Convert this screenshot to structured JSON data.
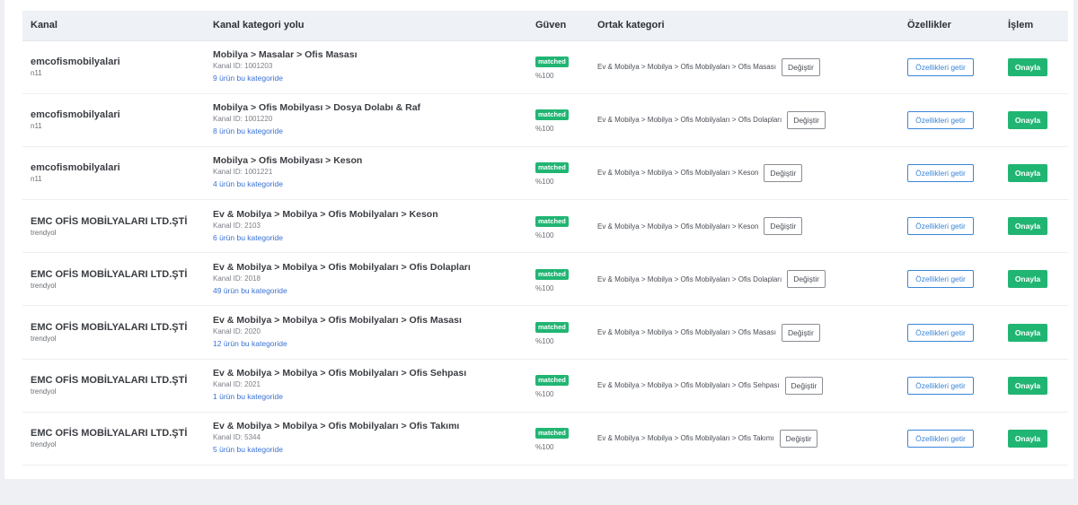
{
  "headers": {
    "kanal": "Kanal",
    "path": "Kanal kategori yolu",
    "guven": "Güven",
    "ortak": "Ortak kategori",
    "ozellikler": "Özellikler",
    "islem": "İşlem"
  },
  "rows": [
    {
      "channel": "emcofismobilyalari",
      "source": "n11",
      "path": "Mobilya > Masalar > Ofis Masası",
      "channel_id": "Kanal ID: 1001203",
      "count": "9 ürün bu kategoride",
      "badge": "matched",
      "confidence": "%100",
      "ortak": "Ev & Mobilya > Mobilya > Ofis Mobilyaları > Ofis Masası",
      "change": "Değiştir",
      "features": "Özellikleri getir",
      "approve": "Onayla"
    },
    {
      "channel": "emcofismobilyalari",
      "source": "n11",
      "path": "Mobilya > Ofis Mobilyası > Dosya Dolabı & Raf",
      "channel_id": "Kanal ID: 1001220",
      "count": "8 ürün bu kategoride",
      "badge": "matched",
      "confidence": "%100",
      "ortak": "Ev & Mobilya > Mobilya > Ofis Mobilyaları > Ofis Dolapları",
      "change": "Değiştir",
      "features": "Özellikleri getir",
      "approve": "Onayla"
    },
    {
      "channel": "emcofismobilyalari",
      "source": "n11",
      "path": "Mobilya > Ofis Mobilyası > Keson",
      "channel_id": "Kanal ID: 1001221",
      "count": "4 ürün bu kategoride",
      "badge": "matched",
      "confidence": "%100",
      "ortak": "Ev & Mobilya > Mobilya > Ofis Mobilyaları > Keson",
      "change": "Değiştir",
      "features": "Özellikleri getir",
      "approve": "Onayla"
    },
    {
      "channel": "EMC OFİS MOBİLYALARI LTD.ŞTİ",
      "source": "trendyol",
      "path": "Ev & Mobilya > Mobilya > Ofis Mobilyaları > Keson",
      "channel_id": "Kanal ID: 2103",
      "count": "6 ürün bu kategoride",
      "badge": "matched",
      "confidence": "%100",
      "ortak": "Ev & Mobilya > Mobilya > Ofis Mobilyaları > Keson",
      "change": "Değiştir",
      "features": "Özellikleri getir",
      "approve": "Onayla"
    },
    {
      "channel": "EMC OFİS MOBİLYALARI LTD.ŞTİ",
      "source": "trendyol",
      "path": "Ev & Mobilya > Mobilya > Ofis Mobilyaları > Ofis Dolapları",
      "channel_id": "Kanal ID: 2018",
      "count": "49 ürün bu kategoride",
      "badge": "matched",
      "confidence": "%100",
      "ortak": "Ev & Mobilya > Mobilya > Ofis Mobilyaları > Ofis Dolapları",
      "change": "Değiştir",
      "features": "Özellikleri getir",
      "approve": "Onayla"
    },
    {
      "channel": "EMC OFİS MOBİLYALARI LTD.ŞTİ",
      "source": "trendyol",
      "path": "Ev & Mobilya > Mobilya > Ofis Mobilyaları > Ofis Masası",
      "channel_id": "Kanal ID: 2020",
      "count": "12 ürün bu kategoride",
      "badge": "matched",
      "confidence": "%100",
      "ortak": "Ev & Mobilya > Mobilya > Ofis Mobilyaları > Ofis Masası",
      "change": "Değiştir",
      "features": "Özellikleri getir",
      "approve": "Onayla"
    },
    {
      "channel": "EMC OFİS MOBİLYALARI LTD.ŞTİ",
      "source": "trendyol",
      "path": "Ev & Mobilya > Mobilya > Ofis Mobilyaları > Ofis Sehpası",
      "channel_id": "Kanal ID: 2021",
      "count": "1 ürün bu kategoride",
      "badge": "matched",
      "confidence": "%100",
      "ortak": "Ev & Mobilya > Mobilya > Ofis Mobilyaları > Ofis Sehpası",
      "change": "Değiştir",
      "features": "Özellikleri getir",
      "approve": "Onayla"
    },
    {
      "channel": "EMC OFİS MOBİLYALARI LTD.ŞTİ",
      "source": "trendyol",
      "path": "Ev & Mobilya > Mobilya > Ofis Mobilyaları > Ofis Takımı",
      "channel_id": "Kanal ID: 5344",
      "count": "5 ürün bu kategoride",
      "badge": "matched",
      "confidence": "%100",
      "ortak": "Ev & Mobilya > Mobilya > Ofis Mobilyaları > Ofis Takımı",
      "change": "Değiştir",
      "features": "Özellikleri getir",
      "approve": "Onayla"
    }
  ]
}
